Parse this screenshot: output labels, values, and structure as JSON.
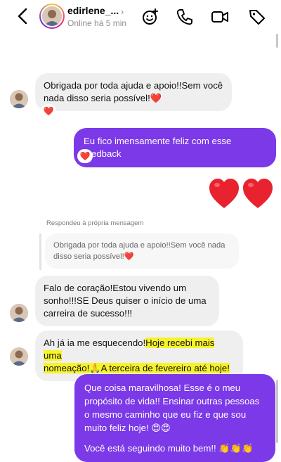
{
  "header": {
    "contact_name": "edirlene_...",
    "status": "Online há 5 min"
  },
  "messages": [
    {
      "sender": "contact",
      "text": "Obrigada por toda ajuda e apoio!!Sem você nada disso seria possível!",
      "emoji": "❤️",
      "reaction": "❤️"
    },
    {
      "sender": "me",
      "text": "Eu fico imensamente feliz com esse feedback",
      "reaction": "❤️"
    },
    {
      "sender": "me",
      "text": "❤️❤️"
    },
    {
      "sender": "contact",
      "reply_label": "Respondeu à própria mensagem",
      "quoted": "Obrigada por toda ajuda e apoio!!Sem você nada disso seria possível!❤️",
      "text": "Falo de coração!Estou vivendo um sonho!!!SE Deus quiser o início de uma carreira de sucesso!!!"
    },
    {
      "sender": "contact",
      "text_plain": "Ah já ia me esquecendo!",
      "text_highlight_1": "Hoje recebi mais uma",
      "text_highlight_2": "nomeação!🙏A terceira de fevereiro até hoje!"
    },
    {
      "sender": "me",
      "text": "Que coisa maravilhosa! Esse é o meu propósito de vida!! Ensinar outras pessoas o mesmo caminho que eu fiz e que sou muito feliz hoje!  😍😍",
      "text2": "Você está seguindo muito bem!! 👏👏👏"
    }
  ]
}
